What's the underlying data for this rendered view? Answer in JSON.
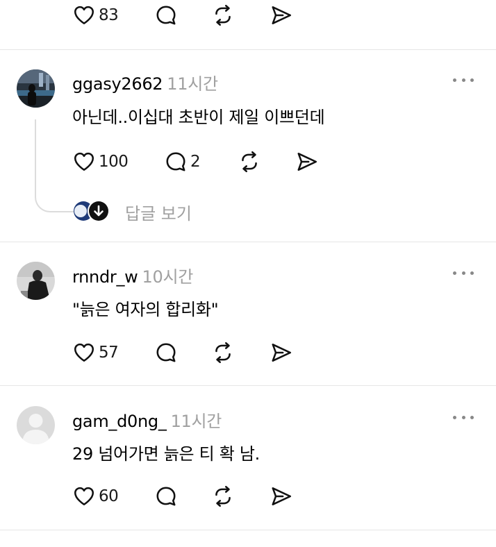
{
  "top_post": {
    "likes": "83"
  },
  "comments": [
    {
      "username": "ggasy2662",
      "time": "11시간",
      "text": "아닌데..이십대 초반이 제일 이쁘던데",
      "likes": "100",
      "replies": "2",
      "view_replies_label": "답글 보기"
    },
    {
      "username": "rnndr_w",
      "time": "10시간",
      "text": "\"늙은 여자의 합리화\"",
      "likes": "57"
    },
    {
      "username": "gam_d0ng_",
      "time": "11시간",
      "text": "29 넘어가면 늙은 티 확 남.",
      "likes": "60"
    }
  ],
  "icons": {
    "like": "heart-icon",
    "reply": "comment-bubble-icon",
    "repost": "repost-icon",
    "share": "send-icon",
    "more": "more-options-icon",
    "reply_indicator": "arrow-down-icon"
  },
  "colors": {
    "text": "#000000",
    "muted": "#a0a0a0",
    "divider": "#e6e6e6"
  }
}
